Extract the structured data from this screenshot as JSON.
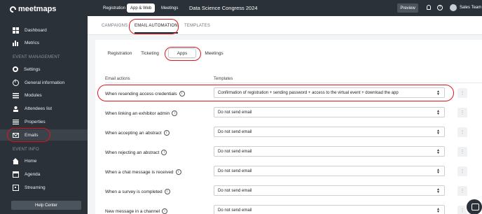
{
  "brand": {
    "logo_text": "meetmaps"
  },
  "sidebar": {
    "items": [
      {
        "label": "Dashboard",
        "icon": "dashboard-icon"
      },
      {
        "label": "Metrics",
        "icon": "metrics-icon"
      }
    ],
    "section_event_management": "EVENT MANAGEMENT",
    "management_items": [
      {
        "label": "Settings",
        "icon": "gear-icon"
      },
      {
        "label": "General information",
        "icon": "info-icon"
      },
      {
        "label": "Modules",
        "icon": "modules-icon"
      },
      {
        "label": "Attendees list",
        "icon": "people-icon"
      },
      {
        "label": "Properties",
        "icon": "list-icon"
      },
      {
        "label": "Emails",
        "icon": "mail-icon",
        "active": true
      }
    ],
    "section_event_info": "EVENT INFO",
    "info_items": [
      {
        "label": "Home",
        "icon": "home-icon"
      },
      {
        "label": "Agenda",
        "icon": "calendar-icon"
      },
      {
        "label": "Streaming",
        "icon": "streaming-icon"
      }
    ],
    "help_center": "Help Center"
  },
  "topbar": {
    "tabs": [
      "Registration",
      "App & Web",
      "Meetings"
    ],
    "active_tab": "App & Web",
    "event_title": "Data Science Congress 2024",
    "preview": "Preview",
    "help": "?",
    "user_name": "Sales Team"
  },
  "main": {
    "tabs": [
      "CAMPAIGNS",
      "EMAIL AUTOMATION",
      "TEMPLATES"
    ],
    "active_tab": "EMAIL AUTOMATION",
    "sub_tabs": [
      "Registration",
      "Ticketing",
      "Apps",
      "Meetings"
    ],
    "active_sub_tab": "Apps",
    "columns": {
      "actions": "Email actions",
      "templates": "Templates"
    },
    "rows": [
      {
        "action": "When resending access credentials",
        "template": "Confirmation of registration + sending password + access to the virtual event + download the app"
      },
      {
        "action": "When linking an exhibitor admin",
        "template": "Do not send email"
      },
      {
        "action": "When accepting an abstract",
        "template": "Do not send email"
      },
      {
        "action": "When rejecting an abstract",
        "template": "Do not send email"
      },
      {
        "action": "When a chat message is received",
        "template": "Do not send email"
      },
      {
        "action": "When a survey is completed",
        "template": "Do not send email"
      },
      {
        "action": "New message in a channel",
        "template": "Do not send email"
      }
    ]
  },
  "colors": {
    "sidebar_bg": "#2b3138",
    "annotation_red": "#e0161e",
    "page_bg": "#f3f4f6"
  }
}
